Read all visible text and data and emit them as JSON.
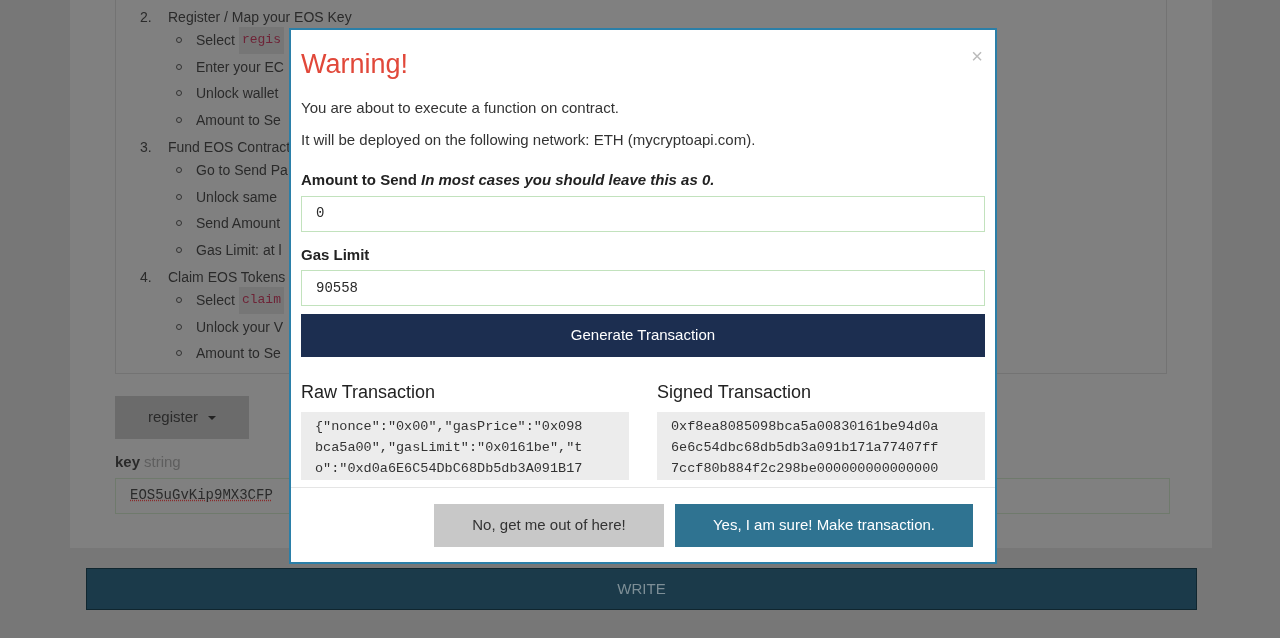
{
  "background": {
    "steps": [
      {
        "number": "2.",
        "title": "Register / Map your EOS Key",
        "items": [
          {
            "text": "Select ",
            "code": "regis"
          },
          {
            "text": "Enter your EC"
          },
          {
            "text": "Unlock wallet"
          },
          {
            "text": "Amount to Se"
          }
        ]
      },
      {
        "number": "3.",
        "title": "Fund EOS Contract",
        "items": [
          {
            "text": "Go to Send Pa"
          },
          {
            "text": "Unlock same"
          },
          {
            "text": "Send Amount"
          },
          {
            "text": "Gas Limit: at l"
          }
        ]
      },
      {
        "number": "4.",
        "title": "Claim EOS Tokens",
        "items": [
          {
            "text": "Select ",
            "code": "claim"
          },
          {
            "text": "Unlock your V"
          },
          {
            "text": "Amount to Se"
          }
        ]
      }
    ],
    "function_dropdown": "register",
    "key_label": "key",
    "key_type": "string",
    "key_value": "EOS5uGvKip9MX3CFP",
    "write_button": "WRITE"
  },
  "modal": {
    "title": "Warning!",
    "close": "×",
    "messages": [
      "You are about to execute a function on contract.",
      "It will be deployed on the following network: ETH (mycryptoapi.com)."
    ],
    "amount": {
      "label": "Amount to Send *In most cases you should leave this as 0.*",
      "value": "0"
    },
    "gas": {
      "label": "Gas Limit",
      "value": "90558"
    },
    "generate_button": "Generate Transaction",
    "raw": {
      "label": "Raw Transaction",
      "value": "{\"nonce\":\"0x00\",\"gasPrice\":\"0x098bca5a00\",\"gasLimit\":\"0x0161be\",\"to\":\"0xd0a6E6C54DbC68Db5db3A091B17"
    },
    "signed": {
      "label": "Signed Transaction",
      "value": "0xf8ea8085098bca5a00830161be94d0a6e6c54dbc68db5db3a091b171a77407ff7ccf80b884f2c298be000000000000000"
    },
    "cancel_button": "No, get me out of here!",
    "confirm_button": "Yes, I am sure! Make transaction."
  }
}
